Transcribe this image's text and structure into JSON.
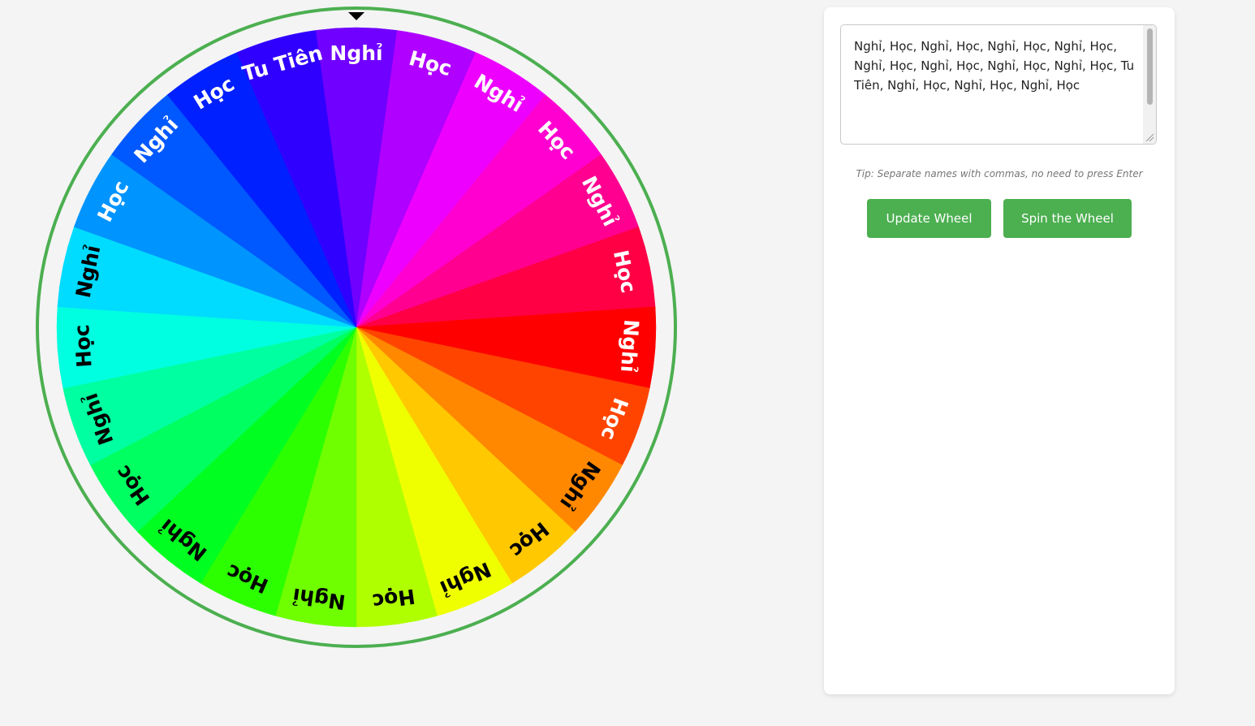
{
  "wheel": {
    "segments": [
      {
        "label": "Nghỉ",
        "color": "#7000ff",
        "text_color": "#ffffff"
      },
      {
        "label": "Học",
        "color": "#b000ff",
        "text_color": "#ffffff"
      },
      {
        "label": "Nghỉ",
        "color": "#ee00ff",
        "text_color": "#ffffff"
      },
      {
        "label": "Học",
        "color": "#ff00d0",
        "text_color": "#ffffff"
      },
      {
        "label": "Nghỉ",
        "color": "#ff0090",
        "text_color": "#ffffff"
      },
      {
        "label": "Học",
        "color": "#ff0045",
        "text_color": "#ffffff"
      },
      {
        "label": "Nghỉ",
        "color": "#ff0000",
        "text_color": "#ffffff"
      },
      {
        "label": "Học",
        "color": "#ff4400",
        "text_color": "#ffffff"
      },
      {
        "label": "Nghỉ",
        "color": "#ff8800",
        "text_color": "#000000"
      },
      {
        "label": "Học",
        "color": "#ffc800",
        "text_color": "#000000"
      },
      {
        "label": "Nghỉ",
        "color": "#f0ff00",
        "text_color": "#000000"
      },
      {
        "label": "Học",
        "color": "#b0ff00",
        "text_color": "#000000"
      },
      {
        "label": "Nghỉ",
        "color": "#70ff00",
        "text_color": "#000000"
      },
      {
        "label": "Học",
        "color": "#2cff00",
        "text_color": "#000000"
      },
      {
        "label": "Nghỉ",
        "color": "#00ff20",
        "text_color": "#000000"
      },
      {
        "label": "Học",
        "color": "#00ff60",
        "text_color": "#000000"
      },
      {
        "label": "Nghỉ",
        "color": "#00ffa0",
        "text_color": "#000000"
      },
      {
        "label": "Học",
        "color": "#00ffe0",
        "text_color": "#000000"
      },
      {
        "label": "Nghỉ",
        "color": "#00dcff",
        "text_color": "#000000"
      },
      {
        "label": "Học",
        "color": "#0094ff",
        "text_color": "#ffffff"
      },
      {
        "label": "Nghỉ",
        "color": "#0058ff",
        "text_color": "#ffffff"
      },
      {
        "label": "Học",
        "color": "#0020ff",
        "text_color": "#ffffff"
      },
      {
        "label": "Tu Tiên",
        "color": "#3000ff",
        "text_color": "#ffffff"
      }
    ],
    "rim_color": "#4caf50",
    "pointer_color": "#000000"
  },
  "panel": {
    "names_text": "Nghỉ, Học, Nghỉ, Học, Nghỉ, Học, Nghỉ, Học, Nghỉ, Học, Nghỉ, Học, Nghỉ, Học, Nghỉ, Học, Tu Tiên, Nghỉ, Học, Nghỉ, Học, Nghỉ, Học",
    "tip": "Tip: Separate names with commas, no need to press Enter",
    "update_label": "Update Wheel",
    "spin_label": "Spin the Wheel",
    "button_color": "#4caf50"
  }
}
